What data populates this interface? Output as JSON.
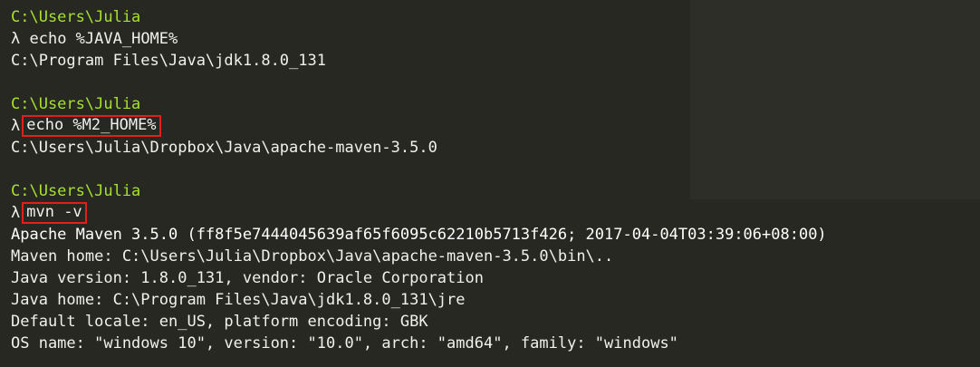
{
  "session": [
    {
      "prompt_path": "C:\\Users\\Julia",
      "prompt_symbol": "λ",
      "command": "echo %JAVA_HOME%",
      "highlighted": false,
      "output": [
        "C:\\Program Files\\Java\\jdk1.8.0_131"
      ]
    },
    {
      "prompt_path": "C:\\Users\\Julia",
      "prompt_symbol": "λ",
      "command": "echo %M2_HOME%",
      "highlighted": true,
      "output": [
        "C:\\Users\\Julia\\Dropbox\\Java\\apache-maven-3.5.0"
      ]
    },
    {
      "prompt_path": "C:\\Users\\Julia",
      "prompt_symbol": "λ",
      "command": "mvn -v",
      "highlighted": true,
      "output": [
        "Apache Maven 3.5.0 (ff8f5e7444045639af65f6095c62210b5713f426; 2017-04-04T03:39:06+08:00)",
        "Maven home: C:\\Users\\Julia\\Dropbox\\Java\\apache-maven-3.5.0\\bin\\..",
        "Java version: 1.8.0_131, vendor: Oracle Corporation",
        "Java home: C:\\Program Files\\Java\\jdk1.8.0_131\\jre",
        "Default locale: en_US, platform encoding: GBK",
        "OS name: \"windows 10\", version: \"10.0\", arch: \"amd64\", family: \"windows\""
      ]
    }
  ],
  "colors": {
    "background": "#272822",
    "prompt_path": "#a6e22e",
    "text": "#f1f1eb",
    "highlight_border": "#e0201b"
  }
}
